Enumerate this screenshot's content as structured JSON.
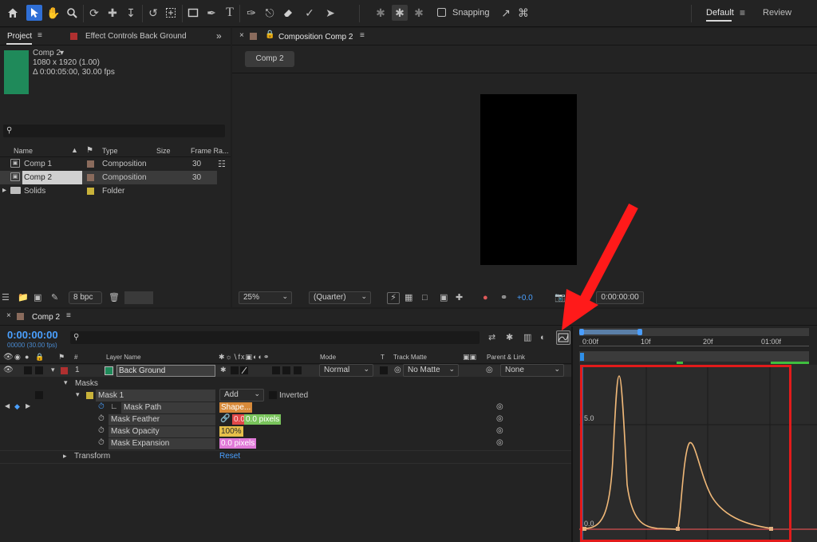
{
  "toolbar": {
    "snapping_label": "Snapping",
    "workspaces": [
      "Default",
      "Review"
    ]
  },
  "project_panel": {
    "tab_project": "Project",
    "tab_effect_controls": "Effect Controls Back Ground",
    "preview": {
      "name": "Comp 2",
      "size": "1080 x 1920 (1.00)",
      "duration": "Δ 0:00:05:00, 30.00 fps",
      "thumb_color": "#1f8a5a"
    },
    "search_placeholder": "",
    "columns": [
      "Name",
      "Type",
      "Size",
      "Frame Ra..."
    ],
    "items": [
      {
        "name": "Comp 1",
        "type": "Composition",
        "size": "",
        "frame_rate": "30",
        "label_color": "#8a6b5c"
      },
      {
        "name": "Comp 2",
        "type": "Composition",
        "size": "",
        "frame_rate": "30",
        "label_color": "#8a6b5c"
      },
      {
        "name": "Solids",
        "type": "Folder",
        "size": "",
        "frame_rate": "",
        "label_color": "#c8b23a"
      }
    ],
    "bpc": "8 bpc"
  },
  "composition_panel": {
    "tab_title": "Composition Comp 2",
    "chip": "Comp 2",
    "zoom": "25%",
    "resolution": "(Quarter)",
    "exposure": "+0.0",
    "timecode": "0:00:00:00"
  },
  "timeline": {
    "tab_title": "Comp 2",
    "current_time": "0:00:00:00",
    "frame_info": "00000 (30.00 fps)",
    "search_placeholder": "",
    "columns": {
      "layer_name": "Layer Name",
      "mode": "Mode",
      "t": "T",
      "track_matte": "Track Matte",
      "parent_link": "Parent & Link"
    },
    "layer": {
      "number": "1",
      "name": "Back Ground",
      "mode": "Normal",
      "track_matte": "No Matte",
      "parent": "None",
      "label_color": "#1f8a5a"
    },
    "masks_label": "Masks",
    "mask": {
      "name": "Mask 1",
      "mode": "Add",
      "inverted_label": "Inverted",
      "label_color": "#c8b23a"
    },
    "properties": [
      {
        "name": "Mask Path",
        "value": "Shape..."
      },
      {
        "name": "Mask Feather",
        "value": "0.0,",
        "value2": "0.0 pixels"
      },
      {
        "name": "Mask Opacity",
        "value": "100%"
      },
      {
        "name": "Mask Expansion",
        "value": "0.0 pixels"
      }
    ],
    "transform_label": "Transform",
    "reset_label": "Reset",
    "ruler": [
      "0:00f",
      "10f",
      "20f",
      "01:00f"
    ],
    "graph_labels": [
      "5.0",
      "0.0"
    ]
  },
  "annotation": {
    "arrow_color": "#ff1a1a",
    "box_color": "#e21b1b"
  }
}
